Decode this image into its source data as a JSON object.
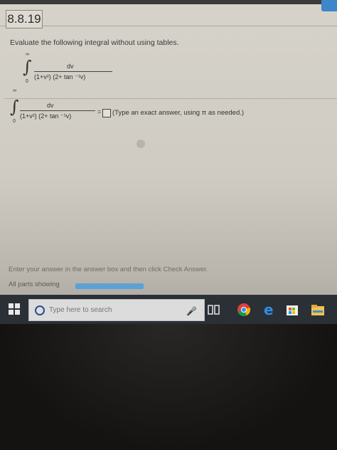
{
  "header": {
    "problem_id": "8.8.19"
  },
  "question": {
    "instruction": "Evaluate the following integral without using tables.",
    "integral": {
      "upper_limit": "∞",
      "lower_limit": "0",
      "numerator": "dv",
      "denominator": "(1+v²) (2+ tan ⁻¹v)"
    }
  },
  "answer": {
    "equals": "=",
    "hint": "(Type an exact answer, using π as needed.)"
  },
  "footer": {
    "instruction": "Enter your answer in the answer box and then click Check Answer.",
    "parts_label": "All parts showing",
    "progress": 1.0
  },
  "taskbar": {
    "search_placeholder": "Type here to search",
    "icons": [
      "windows-start-icon",
      "cortana-icon",
      "microphone-icon",
      "task-view-icon",
      "chrome-icon",
      "edge-icon",
      "store-icon",
      "file-explorer-icon"
    ]
  },
  "colors": {
    "accent": "#3d86c9",
    "progress_fill": "#5aa2d6",
    "taskbar": "#2b2f36"
  }
}
